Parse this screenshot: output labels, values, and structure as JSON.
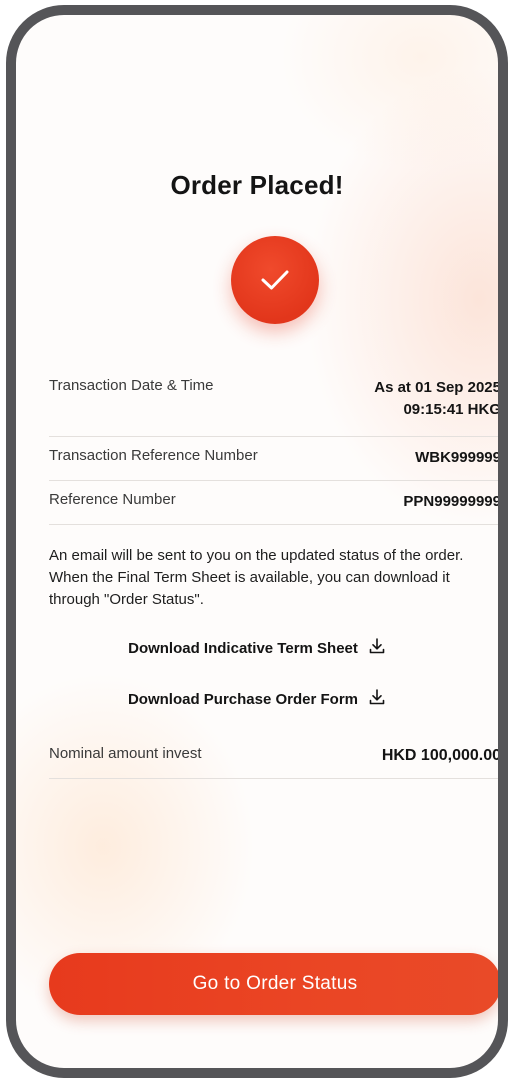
{
  "header": {
    "title": "Order Placed!",
    "status_icon": "checkmark-icon"
  },
  "details": {
    "transaction_datetime": {
      "label": "Transaction Date & Time",
      "value_line1": "As at 01 Sep 2025",
      "value_line2": "09:15:41 HKG"
    },
    "transaction_reference": {
      "label": "Transaction Reference Number",
      "value": "WBK999999"
    },
    "reference": {
      "label": "Reference Number",
      "value": "PPN99999999"
    }
  },
  "notice": "An email will be sent to you on the updated status of the order. When the Final Term Sheet is available, you can download it through \"Order Status\".",
  "downloads": [
    {
      "label": "Download Indicative Term Sheet",
      "icon": "download-icon"
    },
    {
      "label": "Download Purchase Order Form",
      "icon": "download-icon"
    }
  ],
  "nominal": {
    "label": "Nominal amount invest",
    "value": "HKD 100,000.00"
  },
  "cta": {
    "label": "Go to Order Status"
  },
  "colors": {
    "accent": "#e73a1d",
    "frame": "#555558",
    "text": "#141414"
  }
}
